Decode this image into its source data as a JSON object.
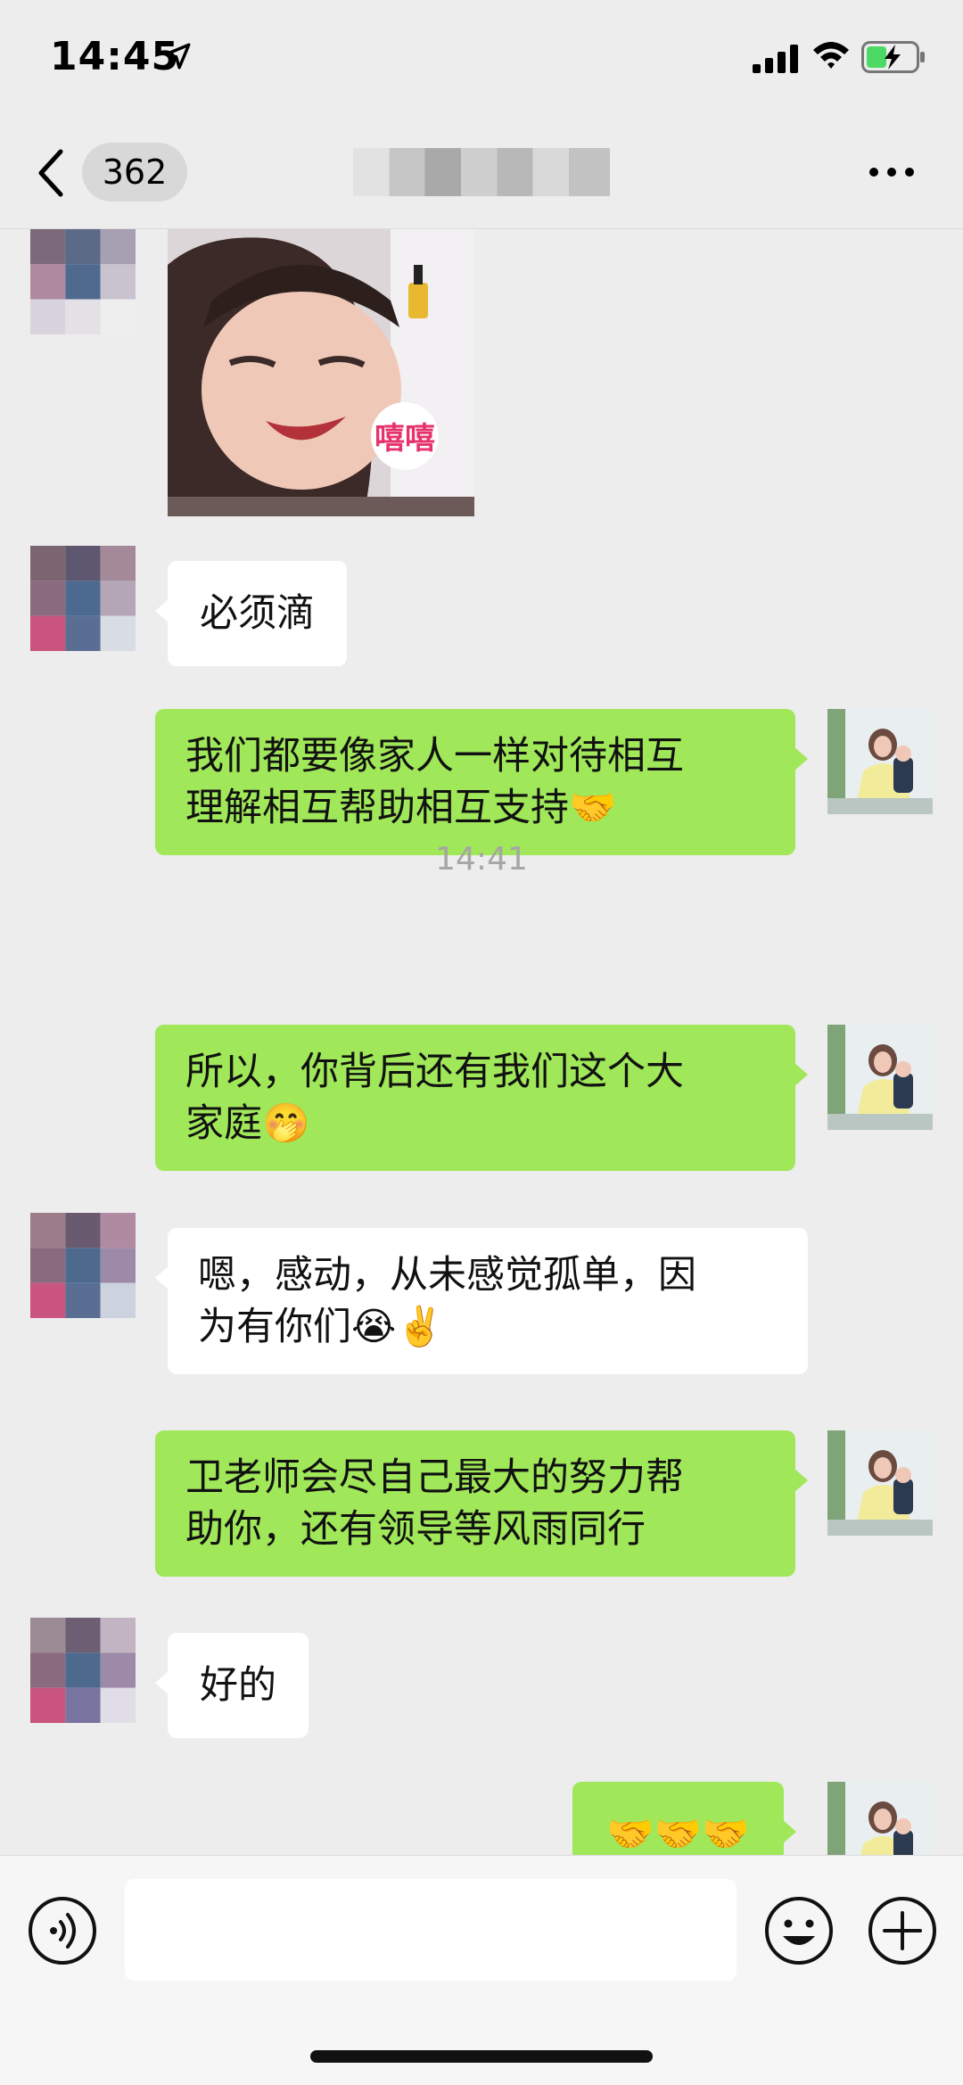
{
  "status_bar": {
    "time": "14:45"
  },
  "nav": {
    "unread_count": "362"
  },
  "messages": [
    {
      "side": "recv",
      "type": "sticker",
      "sticker_text": "嘻嘻"
    },
    {
      "side": "recv",
      "type": "text",
      "text": "必须滴"
    },
    {
      "side": "sent",
      "type": "text",
      "text": "我们都要像家人一样对待相互\n理解相互帮助相互支持🤝"
    },
    {
      "type": "timestamp",
      "text": "14:41"
    },
    {
      "side": "sent",
      "type": "text",
      "text": "所以，你背后还有我们这个大\n家庭🤭"
    },
    {
      "side": "recv",
      "type": "text",
      "text": "嗯，感动，从未感觉孤单，因\n为有你们😭✌️"
    },
    {
      "side": "sent",
      "type": "text",
      "text": "卫老师会尽自己最大的努力帮\n助你，还有领导等风雨同行"
    },
    {
      "side": "recv",
      "type": "text",
      "text": "好的"
    },
    {
      "side": "sent",
      "type": "text",
      "text": "🤝🤝🤝"
    }
  ],
  "input": {
    "placeholder": ""
  },
  "icons": {
    "location": "location-arrow-icon",
    "signal": "cellular-signal-icon",
    "wifi": "wifi-icon",
    "battery": "battery-charging-icon",
    "back": "chevron-left-icon",
    "more": "more-dots-icon",
    "voice": "voice-input-icon",
    "emoji": "emoji-icon",
    "plus": "plus-icon"
  },
  "colors": {
    "sent_bubble": "#a0e759",
    "recv_bubble": "#ffffff",
    "background": "#ededed",
    "battery_charge": "#4cd964"
  }
}
